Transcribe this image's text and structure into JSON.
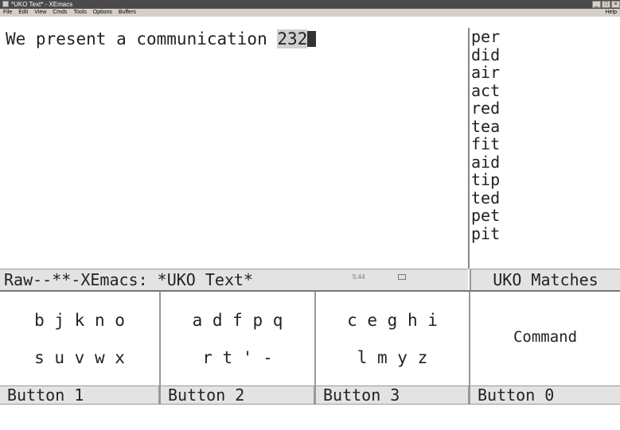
{
  "window": {
    "title": "*UKO Text* - XEmacs"
  },
  "menu": {
    "items": [
      "File",
      "Edit",
      "View",
      "Cmds",
      "Tools",
      "Options",
      "Buffers"
    ],
    "help": "Help"
  },
  "editor": {
    "text_before": "We present a communication ",
    "selection": "232"
  },
  "matches": [
    "per",
    "did",
    "air",
    "act",
    "red",
    "tea",
    "fit",
    "aid",
    "tip",
    "ted",
    "pet",
    "pit"
  ],
  "modeline": {
    "text": "Raw--**-XEmacs: *UKO Text*",
    "status": "5:44"
  },
  "matches_header": "UKO Matches",
  "buttons": [
    {
      "row1": "b j k n o",
      "row2": "s u v w x",
      "label": "Button 1"
    },
    {
      "row1": "a d f p q",
      "row2": "r t ' -",
      "label": "Button 2"
    },
    {
      "row1": "c e g h i",
      "row2": "l m y z",
      "label": "Button 3"
    },
    {
      "command": "Command",
      "label": "Button 0"
    }
  ]
}
